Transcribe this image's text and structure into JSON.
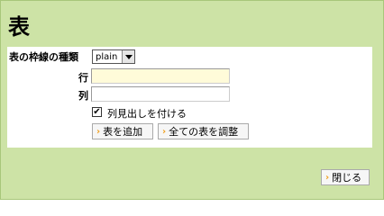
{
  "dialog": {
    "title": "表",
    "border_type_label": "表の枠線の種類",
    "border_type_value": "plain",
    "rows_label": "行",
    "rows_value": "",
    "cols_label": "列",
    "cols_value": "",
    "header_checkbox_label": "列見出しを付ける",
    "header_checked": true,
    "add_table_label": "表を追加",
    "adjust_all_label": "全ての表を調整",
    "close_label": "閉じる"
  },
  "colors": {
    "background": "#cde3a6",
    "input_highlight": "#fffbd9",
    "button_chevron": "#f0a020"
  }
}
